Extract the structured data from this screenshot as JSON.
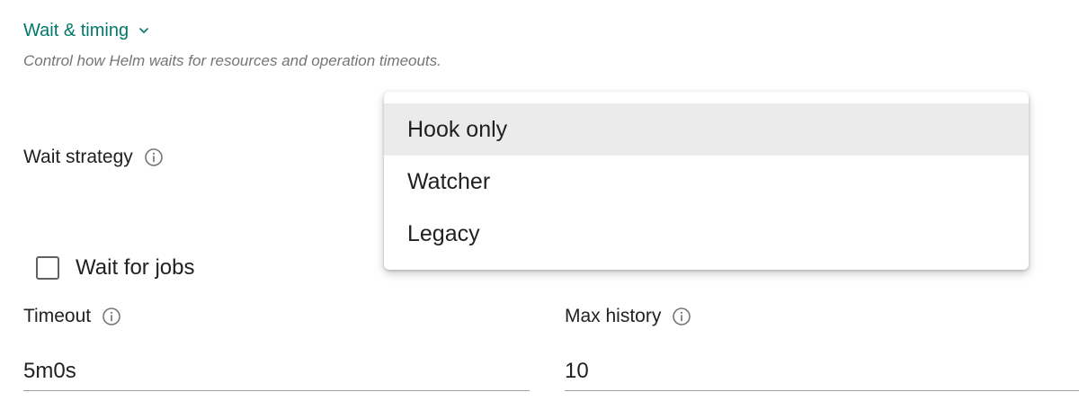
{
  "section": {
    "title": "Wait & timing",
    "description": "Control how Helm waits for resources and operation timeouts."
  },
  "wait_strategy": {
    "label": "Wait strategy",
    "options": [
      {
        "label": "Hook only",
        "highlighted": true
      },
      {
        "label": "Watcher",
        "highlighted": false
      },
      {
        "label": "Legacy",
        "highlighted": false
      }
    ]
  },
  "wait_for_jobs": {
    "label": "Wait for jobs",
    "checked": false
  },
  "timeout": {
    "label": "Timeout",
    "value": "5m0s"
  },
  "max_history": {
    "label": "Max history",
    "value": "10"
  },
  "colors": {
    "accent": "#00796b",
    "menu_highlight": "#ebebeb",
    "muted_text": "#757575"
  },
  "icons": [
    "chevron-down-icon",
    "info-icon"
  ]
}
